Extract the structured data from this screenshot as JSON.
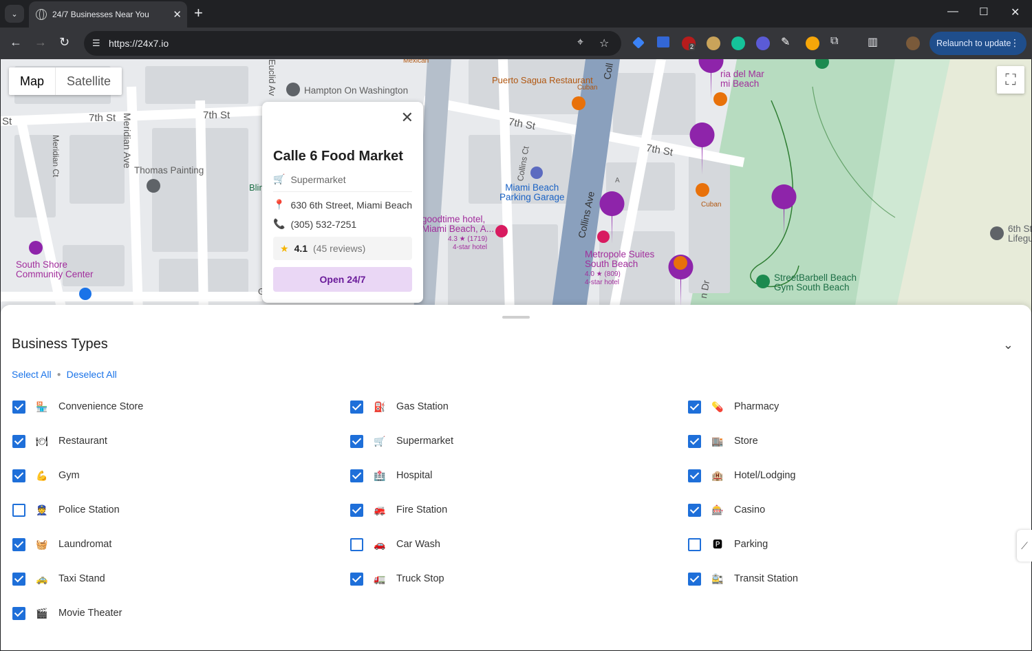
{
  "browser": {
    "tab_title": "24/7 Businesses Near You",
    "url": "https://24x7.io",
    "relaunch_label": "Relaunch to update",
    "ext_badge": "2"
  },
  "map": {
    "type_map": "Map",
    "type_satellite": "Satellite",
    "labels": {
      "hampton": "Hampton On Washington",
      "thomas": "Thomas Painting",
      "south_shore": "South Shore\nCommunity Center",
      "puerto_sagua": "Puerto Sagua Restaurant",
      "cuban1": "Cuban",
      "cuban2": "Cuban",
      "mexican": "Mexican",
      "miami_parking": "Miami Beach\nParking Garage",
      "goodtime": "goodtime hotel,\nMiami Beach, A...",
      "goodtime_rating": "4.3 ★ (1719)",
      "goodtime_class": "4-star hotel",
      "metropole": "Metropole Suites\nSouth Beach",
      "metropole_rating": "4.0 ★ (809)",
      "metropole_class": "4-star hotel",
      "riadelmar": "ria del Mar\nmi Beach",
      "streetbarbell": "StreetBarbell Beach\nGym South Beach",
      "sixth_st": "6th St\nLifegu",
      "st_7_a": "7th St",
      "st_7_b": "7th St",
      "st_7_c": "7th St",
      "st_7_d": "7th St",
      "meridian_ave": "Meridian Ave",
      "meridian_ct": "Meridian Ct",
      "euclid": "Euclid Av",
      "collins_ct": "Collins Ct",
      "collins_ave": "Collins Ave",
      "coll": "Coll",
      "blin": "Blin",
      "dr": "n Dr",
      "letter_a": "A",
      "letter_g": "G",
      "st_edge": "St"
    }
  },
  "infowindow": {
    "name": "Calle 6 Food Market",
    "category": "Supermarket",
    "address": "630 6th Street, Miami Beach",
    "phone": "(305) 532-7251",
    "rating": "4.1",
    "reviews": "(45 reviews)",
    "status": "Open 24/7"
  },
  "sheet": {
    "title": "Business Types",
    "select_all": "Select All",
    "deselect_all": "Deselect All",
    "types": [
      {
        "label": "Convenience Store",
        "emoji": "🏪",
        "checked": true
      },
      {
        "label": "Gas Station",
        "emoji": "⛽",
        "checked": true
      },
      {
        "label": "Pharmacy",
        "emoji": "💊",
        "checked": true
      },
      {
        "label": "Restaurant",
        "emoji": "🍽",
        "checked": true
      },
      {
        "label": "Supermarket",
        "emoji": "🛒",
        "checked": true
      },
      {
        "label": "Store",
        "emoji": "🏬",
        "checked": true
      },
      {
        "label": "Gym",
        "emoji": "💪",
        "checked": true
      },
      {
        "label": "Hospital",
        "emoji": "🏥",
        "checked": true
      },
      {
        "label": "Hotel/Lodging",
        "emoji": "🏨",
        "checked": true
      },
      {
        "label": "Police Station",
        "emoji": "👮",
        "checked": false
      },
      {
        "label": "Fire Station",
        "emoji": "🚒",
        "checked": true
      },
      {
        "label": "Casino",
        "emoji": "🎰",
        "checked": true
      },
      {
        "label": "Laundromat",
        "emoji": "🧺",
        "checked": true
      },
      {
        "label": "Car Wash",
        "emoji": "🚗",
        "checked": false
      },
      {
        "label": "Parking",
        "emoji": "🅿",
        "checked": false
      },
      {
        "label": "Taxi Stand",
        "emoji": "🚕",
        "checked": true
      },
      {
        "label": "Truck Stop",
        "emoji": "🚛",
        "checked": true
      },
      {
        "label": "Transit Station",
        "emoji": "🚉",
        "checked": true
      },
      {
        "label": "Movie Theater",
        "emoji": "🎬",
        "checked": true
      }
    ]
  },
  "colors": {
    "accent": "#1e6fd9",
    "open_bg": "#ead7f5",
    "open_text": "#6a1b9a",
    "marker_purple": "#8e24aa",
    "marker_orange": "#e8710a",
    "park_green": "#7fbf92"
  }
}
